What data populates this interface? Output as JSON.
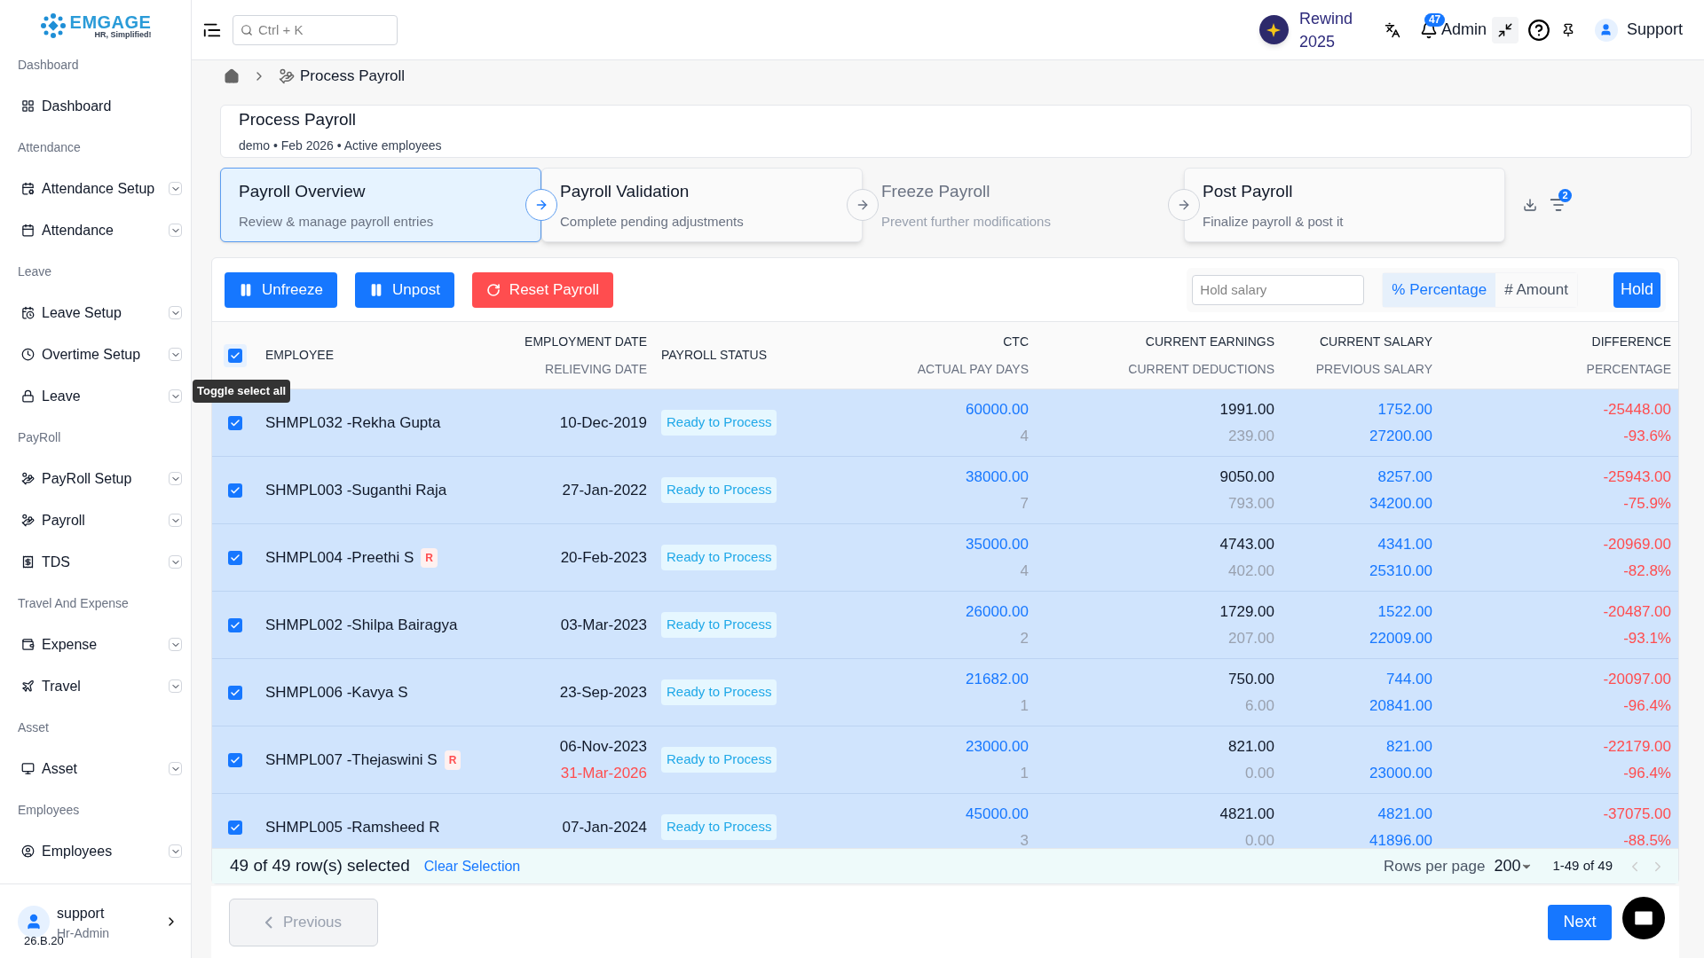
{
  "logo": {
    "name": "EMGAGE",
    "tagline": "HR, Simplified!"
  },
  "sidebar": {
    "sections": [
      {
        "label": "Dashboard",
        "items": [
          {
            "label": "Dashboard",
            "has_submenu": false
          }
        ]
      },
      {
        "label": "Attendance",
        "items": [
          {
            "label": "Attendance Setup",
            "has_submenu": true
          },
          {
            "label": "Attendance",
            "has_submenu": true
          }
        ]
      },
      {
        "label": "Leave",
        "items": [
          {
            "label": "Leave Setup",
            "has_submenu": true
          },
          {
            "label": "Overtime Setup",
            "has_submenu": true
          },
          {
            "label": "Leave",
            "has_submenu": true
          }
        ]
      },
      {
        "label": "PayRoll",
        "items": [
          {
            "label": "PayRoll Setup",
            "has_submenu": true
          },
          {
            "label": "Payroll",
            "has_submenu": true
          },
          {
            "label": "TDS",
            "has_submenu": true
          }
        ]
      },
      {
        "label": "Travel And Expense",
        "items": [
          {
            "label": "Expense",
            "has_submenu": true
          },
          {
            "label": "Travel",
            "has_submenu": true
          }
        ]
      },
      {
        "label": "Asset",
        "items": [
          {
            "label": "Asset",
            "has_submenu": true
          }
        ]
      },
      {
        "label": "Employees",
        "items": [
          {
            "label": "Employees",
            "has_submenu": true
          }
        ]
      }
    ],
    "user": {
      "name": "support",
      "role": "Hr-Admin",
      "version": "26.B.20"
    }
  },
  "topbar": {
    "search_placeholder": "Ctrl + K",
    "rewind": [
      "Rewind",
      "2025"
    ],
    "notifications": "47",
    "role": "Admin",
    "user": "Support"
  },
  "breadcrumb": {
    "current": "Process Payroll"
  },
  "header": {
    "title": "Process Payroll",
    "subtitle": "demo • Feb 2026 • Active employees"
  },
  "steps": [
    {
      "title": "Payroll Overview",
      "subtitle": "Review & manage payroll entries",
      "selected": true,
      "disabled": false
    },
    {
      "title": "Payroll Validation",
      "subtitle": "Complete pending adjustments",
      "selected": false,
      "disabled": false
    },
    {
      "title": "Freeze Payroll",
      "subtitle": "Prevent further modifications",
      "selected": false,
      "disabled": true
    },
    {
      "title": "Post Payroll",
      "subtitle": "Finalize payroll & post it",
      "selected": false,
      "disabled": false
    }
  ],
  "filter_count": "2",
  "actions": [
    {
      "label": "Unfreeze",
      "kind": "pause"
    },
    {
      "label": "Unpost",
      "kind": "pause"
    },
    {
      "label": "Reset Payroll",
      "kind": "reset"
    }
  ],
  "hold": {
    "placeholder": "Hold salary",
    "modes": [
      {
        "label": "% Percentage",
        "selected": true
      },
      {
        "label": "# Amount",
        "selected": false
      }
    ],
    "button": "Hold"
  },
  "table": {
    "all_checked": true,
    "tooltip": "Toggle select all",
    "columns": [
      {
        "top": "EMPLOYEE"
      },
      {
        "top": "EMPLOYMENT DATE",
        "bottom": "RELIEVING DATE"
      },
      {
        "top": "PAYROLL STATUS"
      },
      {
        "top": "CTC",
        "bottom": "ACTUAL PAY DAYS"
      },
      {
        "top": "CURRENT EARNINGS",
        "bottom": "CURRENT DEDUCTIONS"
      },
      {
        "top": "CURRENT SALARY",
        "bottom": "PREVIOUS SALARY"
      },
      {
        "top": "DIFFERENCE",
        "bottom": "PERCENTAGE"
      }
    ],
    "rows": [
      {
        "checked": true,
        "employee": "SHMPL032 -Rekha Gupta",
        "employment_date": "10-Dec-2019",
        "status": "Ready to Process",
        "ctc": "60000.00",
        "pay_days": "4",
        "earnings": "1991.00",
        "deductions": "239.00",
        "current_salary": "1752.00",
        "previous_salary": "27200.00",
        "difference": "-25448.00",
        "percentage": "-93.6%"
      },
      {
        "checked": true,
        "employee": "SHMPL003 -Suganthi Raja",
        "employment_date": "27-Jan-2022",
        "status": "Ready to Process",
        "ctc": "38000.00",
        "pay_days": "7",
        "earnings": "9050.00",
        "deductions": "793.00",
        "current_salary": "8257.00",
        "previous_salary": "34200.00",
        "difference": "-25943.00",
        "percentage": "-75.9%"
      },
      {
        "checked": true,
        "employee": "SHMPL004 -Preethi S",
        "badge": "R",
        "employment_date": "20-Feb-2023",
        "status": "Ready to Process",
        "ctc": "35000.00",
        "pay_days": "4",
        "earnings": "4743.00",
        "deductions": "402.00",
        "current_salary": "4341.00",
        "previous_salary": "25310.00",
        "difference": "-20969.00",
        "percentage": "-82.8%"
      },
      {
        "checked": true,
        "employee": "SHMPL002 -Shilpa Bairagya",
        "employment_date": "03-Mar-2023",
        "status": "Ready to Process",
        "ctc": "26000.00",
        "pay_days": "2",
        "earnings": "1729.00",
        "deductions": "207.00",
        "current_salary": "1522.00",
        "previous_salary": "22009.00",
        "difference": "-20487.00",
        "percentage": "-93.1%"
      },
      {
        "checked": true,
        "employee": "SHMPL006 -Kavya S",
        "employment_date": "23-Sep-2023",
        "status": "Ready to Process",
        "ctc": "21682.00",
        "pay_days": "1",
        "earnings": "750.00",
        "deductions": "6.00",
        "current_salary": "744.00",
        "previous_salary": "20841.00",
        "difference": "-20097.00",
        "percentage": "-96.4%"
      },
      {
        "checked": true,
        "employee": "SHMPL007 -Thejaswini S",
        "badge": "R",
        "employment_date": "06-Nov-2023",
        "relieving_date": "31-Mar-2026",
        "status": "Ready to Process",
        "ctc": "23000.00",
        "pay_days": "1",
        "earnings": "821.00",
        "deductions": "0.00",
        "current_salary": "821.00",
        "previous_salary": "23000.00",
        "difference": "-22179.00",
        "percentage": "-96.4%"
      },
      {
        "checked": true,
        "employee": "SHMPL005 -Ramsheed R",
        "employment_date": "07-Jan-2024",
        "status": "Ready to Process",
        "ctc": "45000.00",
        "pay_days": "3",
        "earnings": "4821.00",
        "deductions": "0.00",
        "current_salary": "4821.00",
        "previous_salary": "41896.00",
        "difference": "-37075.00",
        "percentage": "-88.5%"
      }
    ]
  },
  "selection": {
    "summary": "49 of 49 row(s) selected",
    "clear": "Clear Selection"
  },
  "pagination": {
    "rows_label": "Rows per page",
    "rows_value": "200",
    "range": "1-49 of 49"
  },
  "nav": {
    "previous": "Previous",
    "previous_disabled": true,
    "next": "Next"
  }
}
